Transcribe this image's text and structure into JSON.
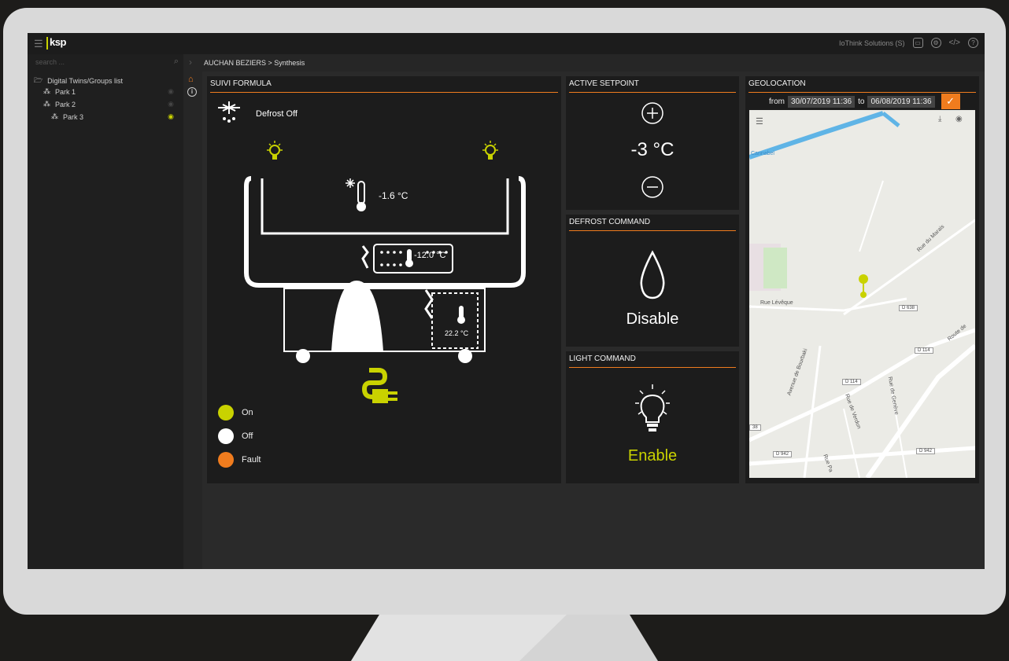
{
  "colors": {
    "accent_orange": "#f07c1e",
    "accent_lime": "#c9d200",
    "panel_bg": "#1c1c1c",
    "map_bg": "#ebebe6",
    "map_road_blue": "#5fb4e6"
  },
  "topbar": {
    "logo_text": "ksp",
    "account_label": "IoThink Solutions (S)",
    "icons": [
      "monitor-icon",
      "settings-icon",
      "code-icon",
      "help-icon"
    ]
  },
  "search": {
    "placeholder": "search ..."
  },
  "breadcrumb": "AUCHAN BEZIERS > Synthesis",
  "sidebar": {
    "root_label": "Digital Twins/Groups list",
    "items": [
      {
        "label": "Park 1",
        "eye_active": false
      },
      {
        "label": "Park 2",
        "eye_active": false
      },
      {
        "label": "Park 3",
        "eye_active": true
      }
    ]
  },
  "suivi": {
    "title": "SUIVI FORMULA",
    "defrost_status": "Defrost Off",
    "inner_temp": "-1.6 °C",
    "evap_temp": "-12.0 °C",
    "condenser_temp": "22.2 °C",
    "legend": [
      {
        "label": "On",
        "color": "#c9d200"
      },
      {
        "label": "Off",
        "color": "#ffffff"
      },
      {
        "label": "Fault",
        "color": "#f07c1e"
      }
    ]
  },
  "setpoint": {
    "title": "ACTIVE SETPOINT",
    "value": "-3 °C"
  },
  "defrost": {
    "title": "DEFROST COMMAND",
    "state": "Disable"
  },
  "light": {
    "title": "LIGHT COMMAND",
    "state": "Enable"
  },
  "geo": {
    "title": "GEOLOCATION",
    "from_label": "from",
    "from_value": "30/07/2019 11:36",
    "to_label": "to",
    "to_value": "06/08/2019 11:36",
    "streets": [
      "Rue Lévêque",
      "Rue du Marais",
      "Avenue de Bourbaki",
      "Rue de Genève",
      "Rue de Verdun",
      "Route de",
      "Cannabel",
      "Rue Pa"
    ],
    "road_tags": [
      "D 638",
      "D 114",
      "D 114",
      "D 942",
      "D 942",
      "38"
    ]
  }
}
